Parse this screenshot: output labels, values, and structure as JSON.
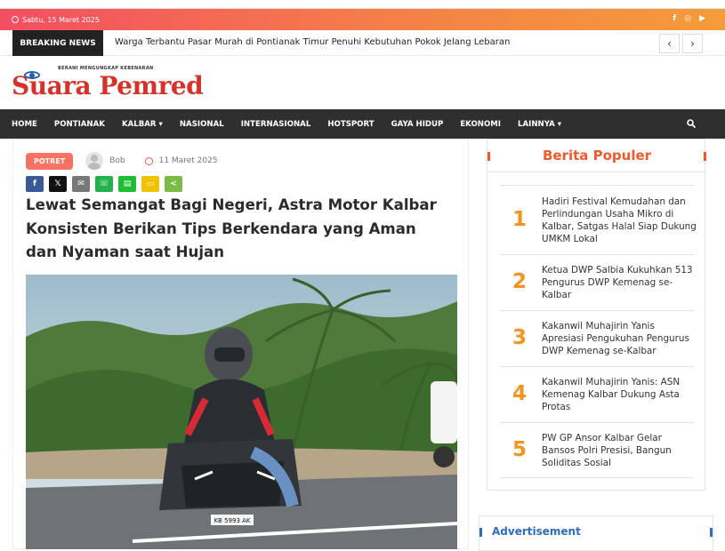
{
  "topbar": {
    "date": "Sabtu, 15 Maret 2025",
    "social_icons": [
      "facebook-icon",
      "instagram-icon",
      "youtube-icon"
    ]
  },
  "breaking": {
    "label": "BREAKING NEWS",
    "headline": "Warga Terbantu Pasar Murah di Pontianak Timur Penuhi Kebutuhan Pokok Jelang Lebaran",
    "prev": "‹",
    "next": "›"
  },
  "site": {
    "name": "Suara Pemred",
    "tagline": "BERANI MENGUNGKAP KEBENARAN",
    "logo_color": "#d7322a"
  },
  "menu": {
    "items": [
      "HOME",
      "PONTIANAK",
      "KALBAR ▾",
      "NASIONAL",
      "INTERNASIONAL",
      "HOTSPORT",
      "GAYA HIDUP",
      "EKONOMI",
      "LAINNYA ▾"
    ]
  },
  "article": {
    "category": "POTRET",
    "author": "Bob",
    "date": "11 Maret 2025",
    "title": "Lewat Semangat Bagi Negeri, Astra Motor Kalbar Konsisten Berikan Tips Berkendara yang Aman dan Nyaman saat Hujan",
    "share": [
      {
        "icon": "facebook-icon",
        "glyph": "f",
        "color": "#3b5998"
      },
      {
        "icon": "x-icon",
        "glyph": "𝕏",
        "color": "#111111"
      },
      {
        "icon": "email-icon",
        "glyph": "✉",
        "color": "#777777"
      },
      {
        "icon": "whatsapp-icon",
        "glyph": "☏",
        "color": "#25b14a"
      },
      {
        "icon": "line-icon",
        "glyph": "▤",
        "color": "#1ebd34"
      },
      {
        "icon": "sms-icon",
        "glyph": "▭",
        "color": "#f2c200"
      },
      {
        "icon": "share-icon",
        "glyph": "<",
        "color": "#7bbc45"
      }
    ],
    "photo_plate": "KB 5993 AK"
  },
  "sidebar": {
    "title": "Berita Populer",
    "items": [
      {
        "num": "1",
        "text": "Hadiri Festival Kemudahan dan Perlindungan Usaha Mikro di Kalbar, Satgas Halal Siap Dukung UMKM Lokal"
      },
      {
        "num": "2",
        "text": "Ketua DWP Salbia Kukuhkan 513 Pengurus DWP Kemenag se-Kalbar"
      },
      {
        "num": "3",
        "text": "Kakanwil Muhajirin Yanis Apresiasi Pengukuhan Pengurus DWP Kemenag se-Kalbar"
      },
      {
        "num": "4",
        "text": "Kakanwil Muhajirin Yanis: ASN Kemenag Kalbar Dukung Asta Protas"
      },
      {
        "num": "5",
        "text": "PW GP Ansor Kalbar Gelar Bansos Polri Presisi, Bangun Soliditas Sosial"
      }
    ]
  },
  "ad": {
    "label": "Advertisement"
  }
}
